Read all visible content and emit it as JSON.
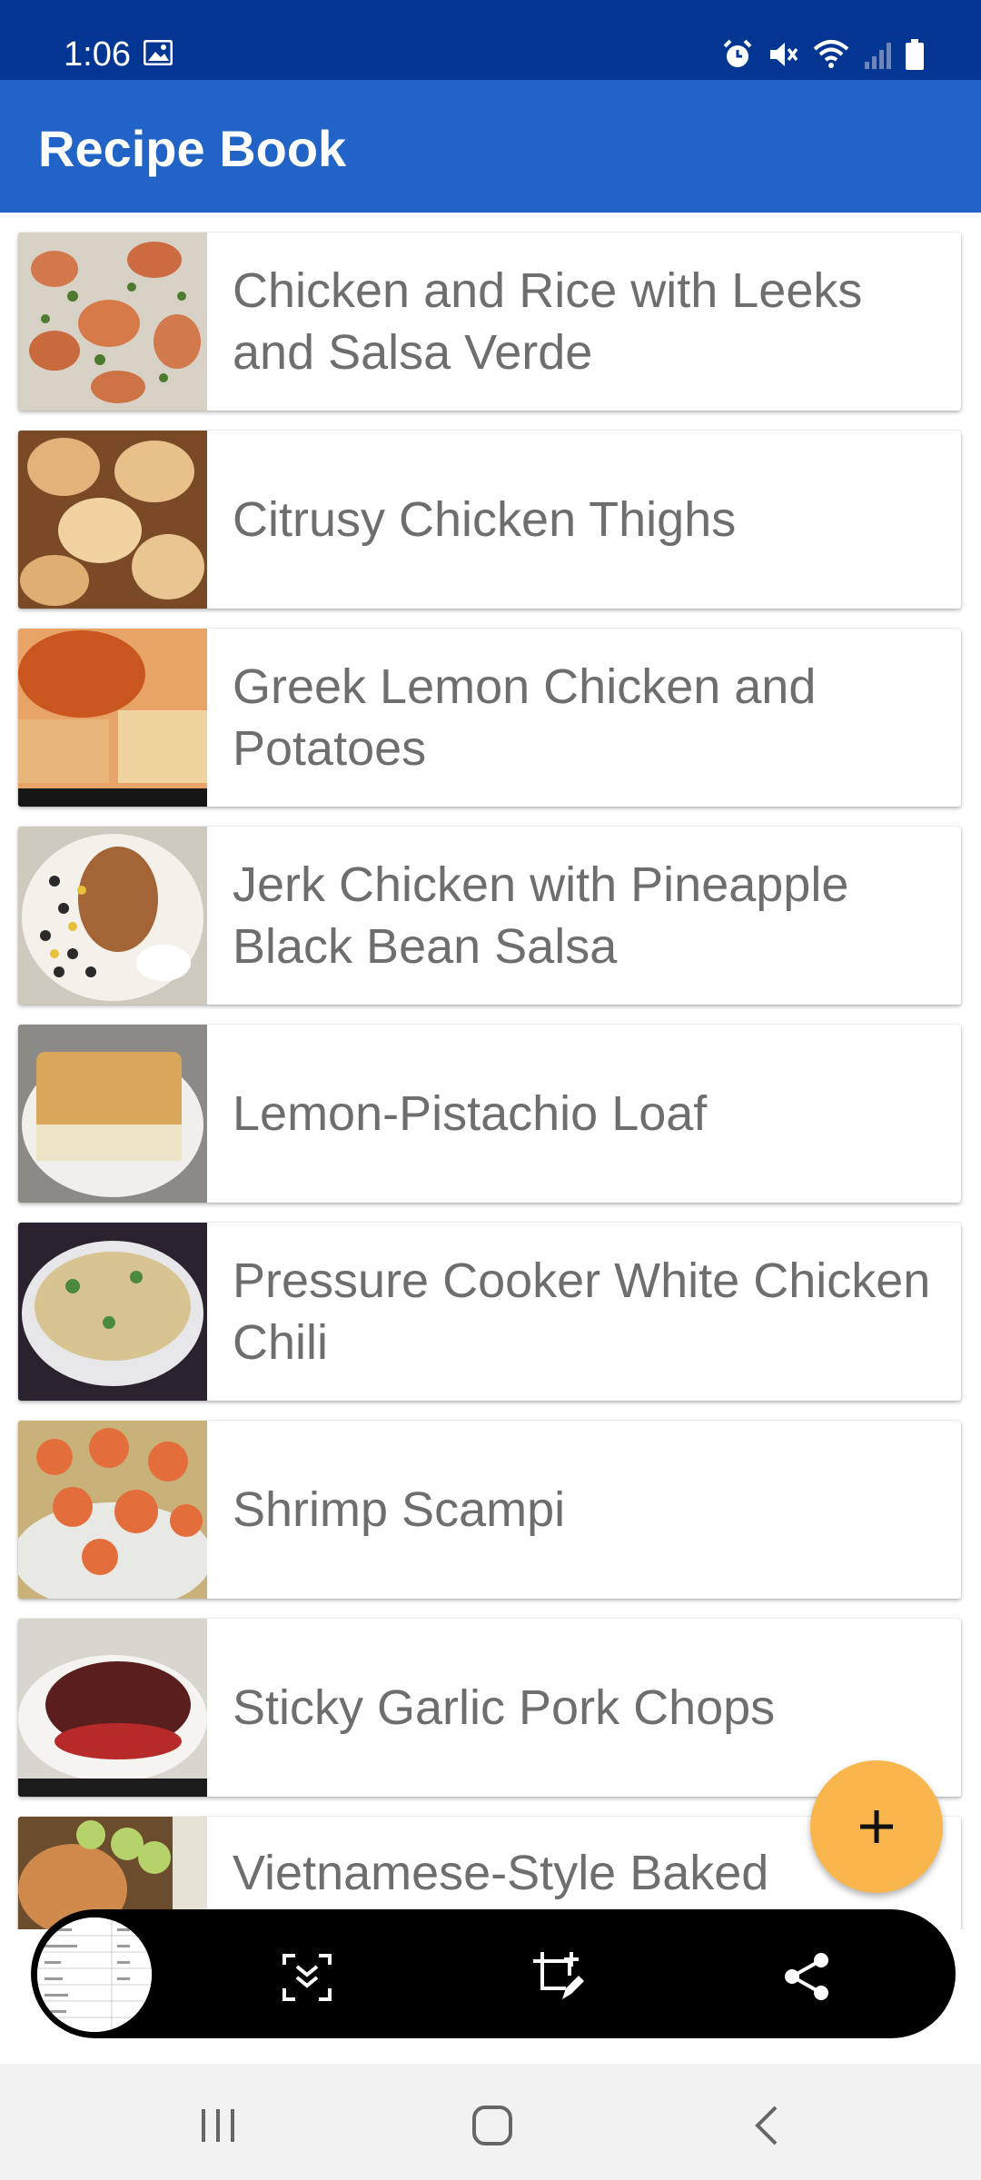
{
  "status_bar": {
    "time": "1:06",
    "icons": [
      "gallery-icon",
      "alarm-icon",
      "mute-icon",
      "wifi-icon",
      "signal-icon",
      "battery-icon"
    ]
  },
  "app_bar": {
    "title": "Recipe Book",
    "color": "#2163c7"
  },
  "recipes": [
    {
      "title": "Chicken and Rice with Leeks and Salsa Verde"
    },
    {
      "title": "Citrusy Chicken Thighs"
    },
    {
      "title": "Greek Lemon Chicken and Potatoes"
    },
    {
      "title": "Jerk Chicken with Pineapple Black Bean Salsa"
    },
    {
      "title": "Lemon-Pistachio Loaf"
    },
    {
      "title": "Pressure Cooker White Chicken Chili"
    },
    {
      "title": "Shrimp Scampi"
    },
    {
      "title": "Sticky Garlic Pork Chops"
    },
    {
      "title": "Vietnamese-Style Baked"
    }
  ],
  "fab": {
    "icon": "plus-icon",
    "color": "#f8b64c"
  },
  "screenshot_toolbar": {
    "tools": [
      "scroll-capture-icon",
      "crop-edit-icon",
      "share-icon"
    ]
  },
  "system_nav": [
    "recents-icon",
    "home-icon",
    "back-icon"
  ]
}
